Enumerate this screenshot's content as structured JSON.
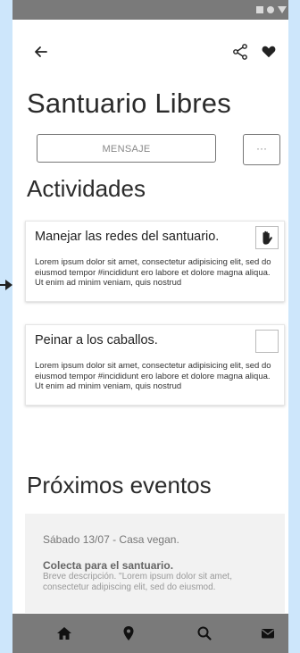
{
  "app": {
    "title": "Santuario Libres"
  },
  "topbar": {
    "icons": [
      "back-arrow",
      "share",
      "heart"
    ]
  },
  "actions": {
    "message_label": "MENSAJE",
    "more_label": "···"
  },
  "activities": {
    "heading": "Actividades",
    "items": [
      {
        "title": "Manejar las redes del santuario.",
        "description": "Lorem ipsum dolor sit amet, consectetur adipisicing elit, sed do eiusmod tempor #incididunt ero labore et dolore magna aliqua. Ut enim ad minim veniam, quis nostrud",
        "status_icon": "hand"
      },
      {
        "title": "Peinar a los caballos.",
        "description": "Lorem ipsum dolor sit amet, consectetur adipisicing elit, sed do eiusmod tempor #incididunt ero labore et dolore magna aliqua. Ut enim ad minim veniam, quis nostrud",
        "status_icon": "empty"
      }
    ]
  },
  "events": {
    "heading": "Próximos eventos",
    "items": [
      {
        "date": "Sábado 13/07 - Casa vegan.",
        "name": "Colecta para el santuario.",
        "description": "Breve descripción. \"Lorem ipsum dolor sit amet, consectetur adipiscing elit, sed do eiusmod."
      }
    ]
  },
  "bottom_nav": {
    "items": [
      "home",
      "location",
      "search",
      "mail"
    ]
  },
  "colors": {
    "background": "#cde6fb",
    "bars": "#7a7a7a",
    "card_bg": "#ffffff",
    "event_bg": "#f2f2f2"
  }
}
